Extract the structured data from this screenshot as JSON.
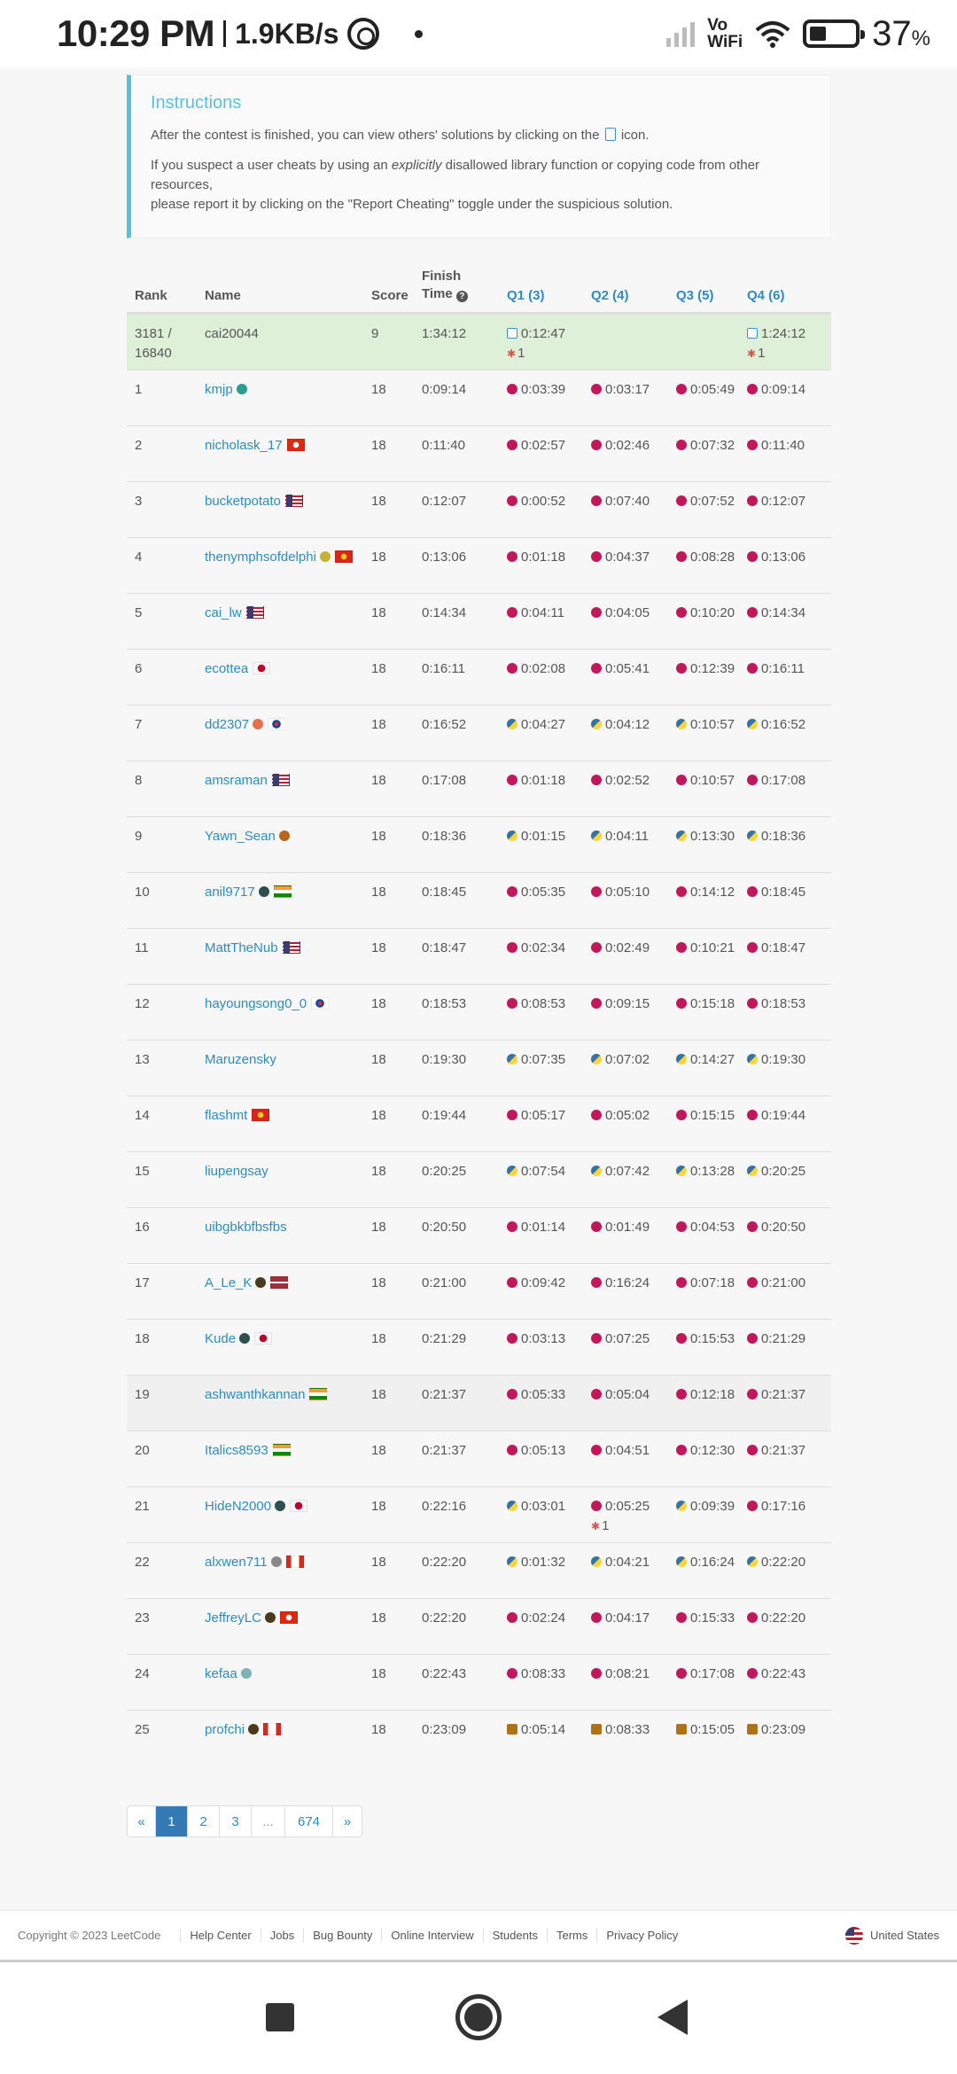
{
  "status_bar": {
    "time": "10:29 PM",
    "speed": "1.9KB/s",
    "network_label": "Vo\nWiFi",
    "battery_level": 37,
    "battery_text": "37",
    "battery_unit": "%"
  },
  "instructions": {
    "title": "Instructions",
    "p1_before": "After the contest is finished, you can view others' solutions by clicking on the",
    "p1_after": "icon.",
    "p2_a": "If you suspect a user cheats by using an ",
    "p2_em": "explicitly",
    "p2_b": " disallowed library function or copying code from other resources,",
    "p2_c": "please report it by clicking on the \"Report Cheating\" toggle under the suspicious solution."
  },
  "table": {
    "headers": {
      "rank": "Rank",
      "name": "Name",
      "score": "Score",
      "finish_time_1": "Finish",
      "finish_time_2": "Time",
      "q1": "Q1 (3)",
      "q2": "Q2 (4)",
      "q3": "Q3 (5)",
      "q4": "Q4 (6)"
    },
    "rows": [
      {
        "rank": "3181 / 16840",
        "name": "cai20044",
        "score": "9",
        "time": "1:34:12",
        "q1": "0:12:47",
        "q1_bug": "1",
        "q2": "",
        "q3": "",
        "q4": "1:24:12",
        "q4_bug": "1",
        "lang": "doc",
        "mine": true
      },
      {
        "rank": "1",
        "name": "kmjp",
        "score": "18",
        "time": "0:09:14",
        "q1": "0:03:39",
        "q2": "0:03:17",
        "q3": "0:05:49",
        "q4": "0:09:14",
        "lang": "c",
        "badge": "#2a9d8f"
      },
      {
        "rank": "2",
        "name": "nicholask_17",
        "score": "18",
        "time": "0:11:40",
        "q1": "0:02:57",
        "q2": "0:02:46",
        "q3": "0:07:32",
        "q4": "0:11:40",
        "lang": "c",
        "flag": "hk"
      },
      {
        "rank": "3",
        "name": "bucketpotato",
        "score": "18",
        "time": "0:12:07",
        "q1": "0:00:52",
        "q2": "0:07:40",
        "q3": "0:07:52",
        "q4": "0:12:07",
        "lang": "c",
        "flag": "us"
      },
      {
        "rank": "4",
        "name": "thenymphsofdelphi",
        "score": "18",
        "time": "0:13:06",
        "q1": "0:01:18",
        "q2": "0:04:37",
        "q3": "0:08:28",
        "q4": "0:13:06",
        "lang": "c",
        "badge": "#c9b037",
        "flag": "vn"
      },
      {
        "rank": "5",
        "name": "cai_lw",
        "score": "18",
        "time": "0:14:34",
        "q1": "0:04:11",
        "q2": "0:04:05",
        "q3": "0:10:20",
        "q4": "0:14:34",
        "lang": "c",
        "flag": "us"
      },
      {
        "rank": "6",
        "name": "ecottea",
        "score": "18",
        "time": "0:16:11",
        "q1": "0:02:08",
        "q2": "0:05:41",
        "q3": "0:12:39",
        "q4": "0:16:11",
        "lang": "c",
        "flag": "jp"
      },
      {
        "rank": "7",
        "name": "dd2307",
        "score": "18",
        "time": "0:16:52",
        "q1": "0:04:27",
        "q2": "0:04:12",
        "q3": "0:10:57",
        "q4": "0:16:52",
        "lang": "py",
        "badge": "#e76f51",
        "flag": "kr"
      },
      {
        "rank": "8",
        "name": "amsraman",
        "score": "18",
        "time": "0:17:08",
        "q1": "0:01:18",
        "q2": "0:02:52",
        "q3": "0:10:57",
        "q4": "0:17:08",
        "lang": "c",
        "flag": "us"
      },
      {
        "rank": "9",
        "name": "Yawn_Sean",
        "score": "18",
        "time": "0:18:36",
        "q1": "0:01:15",
        "q2": "0:04:11",
        "q3": "0:13:30",
        "q4": "0:18:36",
        "lang": "py",
        "badge": "#b5651d"
      },
      {
        "rank": "10",
        "name": "anil9717",
        "score": "18",
        "time": "0:18:45",
        "q1": "0:05:35",
        "q2": "0:05:10",
        "q3": "0:14:12",
        "q4": "0:18:45",
        "lang": "c",
        "badge": "#2f4f4f",
        "flag": "in"
      },
      {
        "rank": "11",
        "name": "MattTheNub",
        "score": "18",
        "time": "0:18:47",
        "q1": "0:02:34",
        "q2": "0:02:49",
        "q3": "0:10:21",
        "q4": "0:18:47",
        "lang": "c",
        "flag": "us"
      },
      {
        "rank": "12",
        "name": "hayoungsong0_0",
        "score": "18",
        "time": "0:18:53",
        "q1": "0:08:53",
        "q2": "0:09:15",
        "q3": "0:15:18",
        "q4": "0:18:53",
        "lang": "c",
        "flag": "kr"
      },
      {
        "rank": "13",
        "name": "Maruzensky",
        "score": "18",
        "time": "0:19:30",
        "q1": "0:07:35",
        "q2": "0:07:02",
        "q3": "0:14:27",
        "q4": "0:19:30",
        "lang": "py"
      },
      {
        "rank": "14",
        "name": "flashmt",
        "score": "18",
        "time": "0:19:44",
        "q1": "0:05:17",
        "q2": "0:05:02",
        "q3": "0:15:15",
        "q4": "0:19:44",
        "lang": "c",
        "flag": "vn"
      },
      {
        "rank": "15",
        "name": "liupengsay",
        "score": "18",
        "time": "0:20:25",
        "q1": "0:07:54",
        "q2": "0:07:42",
        "q3": "0:13:28",
        "q4": "0:20:25",
        "lang": "py"
      },
      {
        "rank": "16",
        "name": "uibgbkbfbsfbs",
        "score": "18",
        "time": "0:20:50",
        "q1": "0:01:14",
        "q2": "0:01:49",
        "q3": "0:04:53",
        "q4": "0:20:50",
        "lang": "c"
      },
      {
        "rank": "17",
        "name": "A_Le_K",
        "score": "18",
        "time": "0:21:00",
        "q1": "0:09:42",
        "q2": "0:16:24",
        "q3": "0:07:18",
        "q4": "0:21:00",
        "lang": "c",
        "badge": "#4a3b1f",
        "flag": "lv"
      },
      {
        "rank": "18",
        "name": "Kude",
        "score": "18",
        "time": "0:21:29",
        "q1": "0:03:13",
        "q2": "0:07:25",
        "q3": "0:15:53",
        "q4": "0:21:29",
        "lang": "c",
        "badge": "#2f4f4f",
        "flag": "jp"
      },
      {
        "rank": "19",
        "name": "ashwanthkannan",
        "score": "18",
        "time": "0:21:37",
        "q1": "0:05:33",
        "q2": "0:05:04",
        "q3": "0:12:18",
        "q4": "0:21:37",
        "lang": "c",
        "flag": "in",
        "highlight": true
      },
      {
        "rank": "20",
        "name": "Italics8593",
        "score": "18",
        "time": "0:21:37",
        "q1": "0:05:13",
        "q2": "0:04:51",
        "q3": "0:12:30",
        "q4": "0:21:37",
        "lang": "c",
        "flag": "in"
      },
      {
        "rank": "21",
        "name": "HideN2000",
        "score": "18",
        "time": "0:22:16",
        "q1": "0:03:01",
        "q2": "0:05:25",
        "q2_bug": "1",
        "q3": "0:09:39",
        "q4": "0:17:16",
        "lang": "mix21",
        "badge": "#2f4f4f",
        "flag": "jp"
      },
      {
        "rank": "22",
        "name": "alxwen711",
        "score": "18",
        "time": "0:22:20",
        "q1": "0:01:32",
        "q2": "0:04:21",
        "q3": "0:16:24",
        "q4": "0:22:20",
        "lang": "py",
        "badge": "#888",
        "flag": "ca"
      },
      {
        "rank": "23",
        "name": "JeffreyLC",
        "score": "18",
        "time": "0:22:20",
        "q1": "0:02:24",
        "q2": "0:04:17",
        "q3": "0:15:33",
        "q4": "0:22:20",
        "lang": "c",
        "badge": "#4a3b1f",
        "flag": "hk"
      },
      {
        "rank": "24",
        "name": "kefaa",
        "score": "18",
        "time": "0:22:43",
        "q1": "0:08:33",
        "q2": "0:08:21",
        "q3": "0:17:08",
        "q4": "0:22:43",
        "lang": "c",
        "badge": "#7fb3b3"
      },
      {
        "rank": "25",
        "name": "profchi",
        "score": "18",
        "time": "0:23:09",
        "q1": "0:05:14",
        "q2": "0:08:33",
        "q3": "0:15:05",
        "q4": "0:23:09",
        "lang": "java",
        "badge": "#4a3b1f",
        "flag": "ca"
      }
    ]
  },
  "pagination": {
    "prev": "«",
    "pages": [
      "1",
      "2",
      "3",
      "...",
      "674"
    ],
    "next": "»",
    "active": "1"
  },
  "footer": {
    "copyright": "Copyright © 2023 LeetCode",
    "links": [
      "Help Center",
      "Jobs",
      "Bug Bounty",
      "Online Interview",
      "Students",
      "Terms",
      "Privacy Policy"
    ],
    "region": "United States"
  },
  "colors": {
    "link": "#2d8cc0",
    "info_accent": "#5bc0de",
    "mine_row": "#dff0d8",
    "page_active": "#337ab7"
  }
}
